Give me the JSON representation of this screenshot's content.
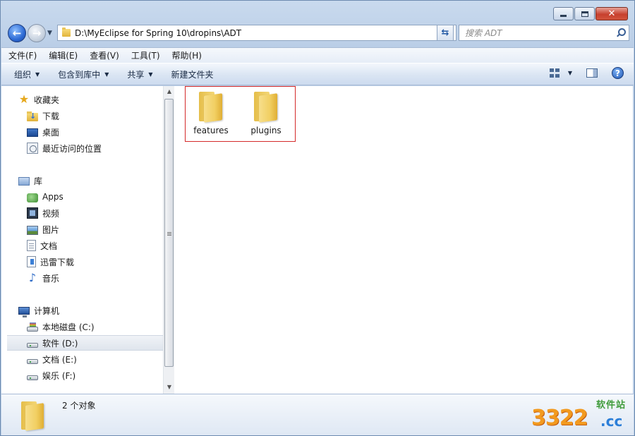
{
  "address": {
    "path": "D:\\MyEclipse for Spring 10\\dropins\\ADT"
  },
  "search": {
    "placeholder": "搜索 ADT"
  },
  "menu": [
    "文件(F)",
    "编辑(E)",
    "查看(V)",
    "工具(T)",
    "帮助(H)"
  ],
  "commands": {
    "organize": "组织",
    "include_in_library": "包含到库中",
    "share": "共享",
    "new_folder": "新建文件夹"
  },
  "sidebar": {
    "favorites": {
      "label": "收藏夹",
      "items": [
        "下载",
        "桌面",
        "最近访问的位置"
      ]
    },
    "libraries": {
      "label": "库",
      "items": [
        "Apps",
        "视频",
        "图片",
        "文档",
        "迅雷下载",
        "音乐"
      ]
    },
    "computer": {
      "label": "计算机",
      "items": [
        "本地磁盘 (C:)",
        "软件 (D:)",
        "文档 (E:)",
        "娱乐 (F:)"
      ],
      "selected": "软件 (D:)"
    }
  },
  "files": [
    {
      "name": "features",
      "type": "folder"
    },
    {
      "name": "plugins",
      "type": "folder"
    }
  ],
  "status": {
    "text": "2 个对象"
  },
  "watermark": {
    "main": "3322",
    "suffix": ".cc",
    "sub": "软件站"
  },
  "icons": {
    "back": "back-arrow-icon",
    "forward": "forward-arrow-icon",
    "refresh": "refresh-icon",
    "search": "search-icon",
    "help": "help-icon"
  }
}
